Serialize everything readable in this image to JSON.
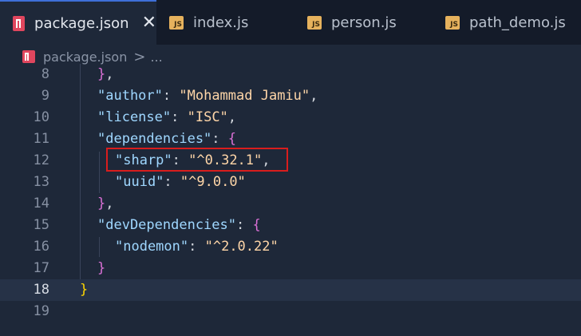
{
  "tabs": [
    {
      "label": "package.json",
      "icon": "npm-icon",
      "active": true
    },
    {
      "label": "index.js",
      "icon": "js-icon",
      "active": false
    },
    {
      "label": "person.js",
      "icon": "js-icon",
      "active": false
    },
    {
      "label": "path_demo.js",
      "icon": "js-icon",
      "active": false
    }
  ],
  "js_badge": "JS",
  "close_glyph": "✕",
  "breadcrumb": {
    "file": "package.json",
    "separator": ">",
    "more": "..."
  },
  "lines": [
    {
      "num": "8",
      "tokens": [
        {
          "t": "}",
          "c": "br2"
        },
        {
          "t": ",",
          "c": "p"
        }
      ]
    },
    {
      "num": "9",
      "tokens": [
        {
          "t": "\"author\"",
          "c": "key"
        },
        {
          "t": ": ",
          "c": "p"
        },
        {
          "t": "\"Mohammad Jamiu\"",
          "c": "str"
        },
        {
          "t": ",",
          "c": "p"
        }
      ]
    },
    {
      "num": "10",
      "tokens": [
        {
          "t": "\"license\"",
          "c": "key"
        },
        {
          "t": ": ",
          "c": "p"
        },
        {
          "t": "\"ISC\"",
          "c": "str"
        },
        {
          "t": ",",
          "c": "p"
        }
      ]
    },
    {
      "num": "11",
      "tokens": [
        {
          "t": "\"dependencies\"",
          "c": "key"
        },
        {
          "t": ": ",
          "c": "p"
        },
        {
          "t": "{",
          "c": "br2"
        }
      ]
    },
    {
      "num": "12",
      "tokens": [
        {
          "t": "\"sharp\"",
          "c": "key"
        },
        {
          "t": ": ",
          "c": "p"
        },
        {
          "t": "\"^0.32.1\"",
          "c": "str"
        },
        {
          "t": ",",
          "c": "p"
        }
      ]
    },
    {
      "num": "13",
      "tokens": [
        {
          "t": "\"uuid\"",
          "c": "key"
        },
        {
          "t": ": ",
          "c": "p"
        },
        {
          "t": "\"^9.0.0\"",
          "c": "str"
        }
      ]
    },
    {
      "num": "14",
      "tokens": [
        {
          "t": "}",
          "c": "br2"
        },
        {
          "t": ",",
          "c": "p"
        }
      ]
    },
    {
      "num": "15",
      "tokens": [
        {
          "t": "\"devDependencies\"",
          "c": "key"
        },
        {
          "t": ": ",
          "c": "p"
        },
        {
          "t": "{",
          "c": "br2"
        }
      ]
    },
    {
      "num": "16",
      "tokens": [
        {
          "t": "\"nodemon\"",
          "c": "key"
        },
        {
          "t": ": ",
          "c": "p"
        },
        {
          "t": "\"^2.0.22\"",
          "c": "str"
        }
      ]
    },
    {
      "num": "17",
      "tokens": [
        {
          "t": "}",
          "c": "br2"
        }
      ]
    },
    {
      "num": "18",
      "tokens": [
        {
          "t": "}",
          "c": "br1"
        }
      ]
    },
    {
      "num": "19",
      "tokens": []
    }
  ],
  "colors": {
    "background": "#1e2839",
    "tabbar": "#141b29",
    "key": "#9fd7ff",
    "string": "#ffd6a8",
    "bracket_outer": "#ffd700",
    "bracket_inner": "#da70d6",
    "highlight_box": "#d91d1d"
  }
}
